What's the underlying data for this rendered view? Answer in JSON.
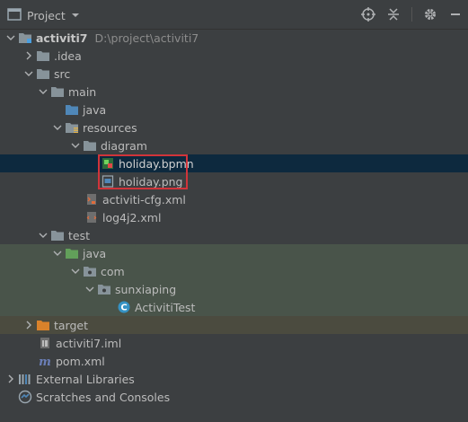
{
  "toolbar": {
    "title": "Project",
    "icons": [
      "target-icon",
      "collapse-icon",
      "gear-icon",
      "hide-icon"
    ]
  },
  "tree": {
    "root": {
      "label": "activiti7",
      "path": "D:\\project\\activiti7"
    },
    "idea": "idea",
    "idea_dot": ".",
    "src": "src",
    "main": "main",
    "java": "java",
    "resources": "resources",
    "diagram": "diagram",
    "holiday_bpmn": "holiday.bpmn",
    "holiday_png": "holiday.png",
    "activiti_cfg": "activiti-cfg.xml",
    "log4j2": "log4j2.xml",
    "test": "test",
    "test_java": "java",
    "com": "com",
    "sunxiaping": "sunxiaping",
    "activiti_test": "ActivitiTest",
    "target": "target",
    "iml": "activiti7.iml",
    "pom": "pom.xml",
    "external_libraries": "External Libraries",
    "scratches": "Scratches and Consoles"
  },
  "colors": {
    "selection": "#0d293e",
    "test_folder": "#49544a",
    "target_folder": "#4b4b3f",
    "highlight_box": "#d0343a"
  }
}
